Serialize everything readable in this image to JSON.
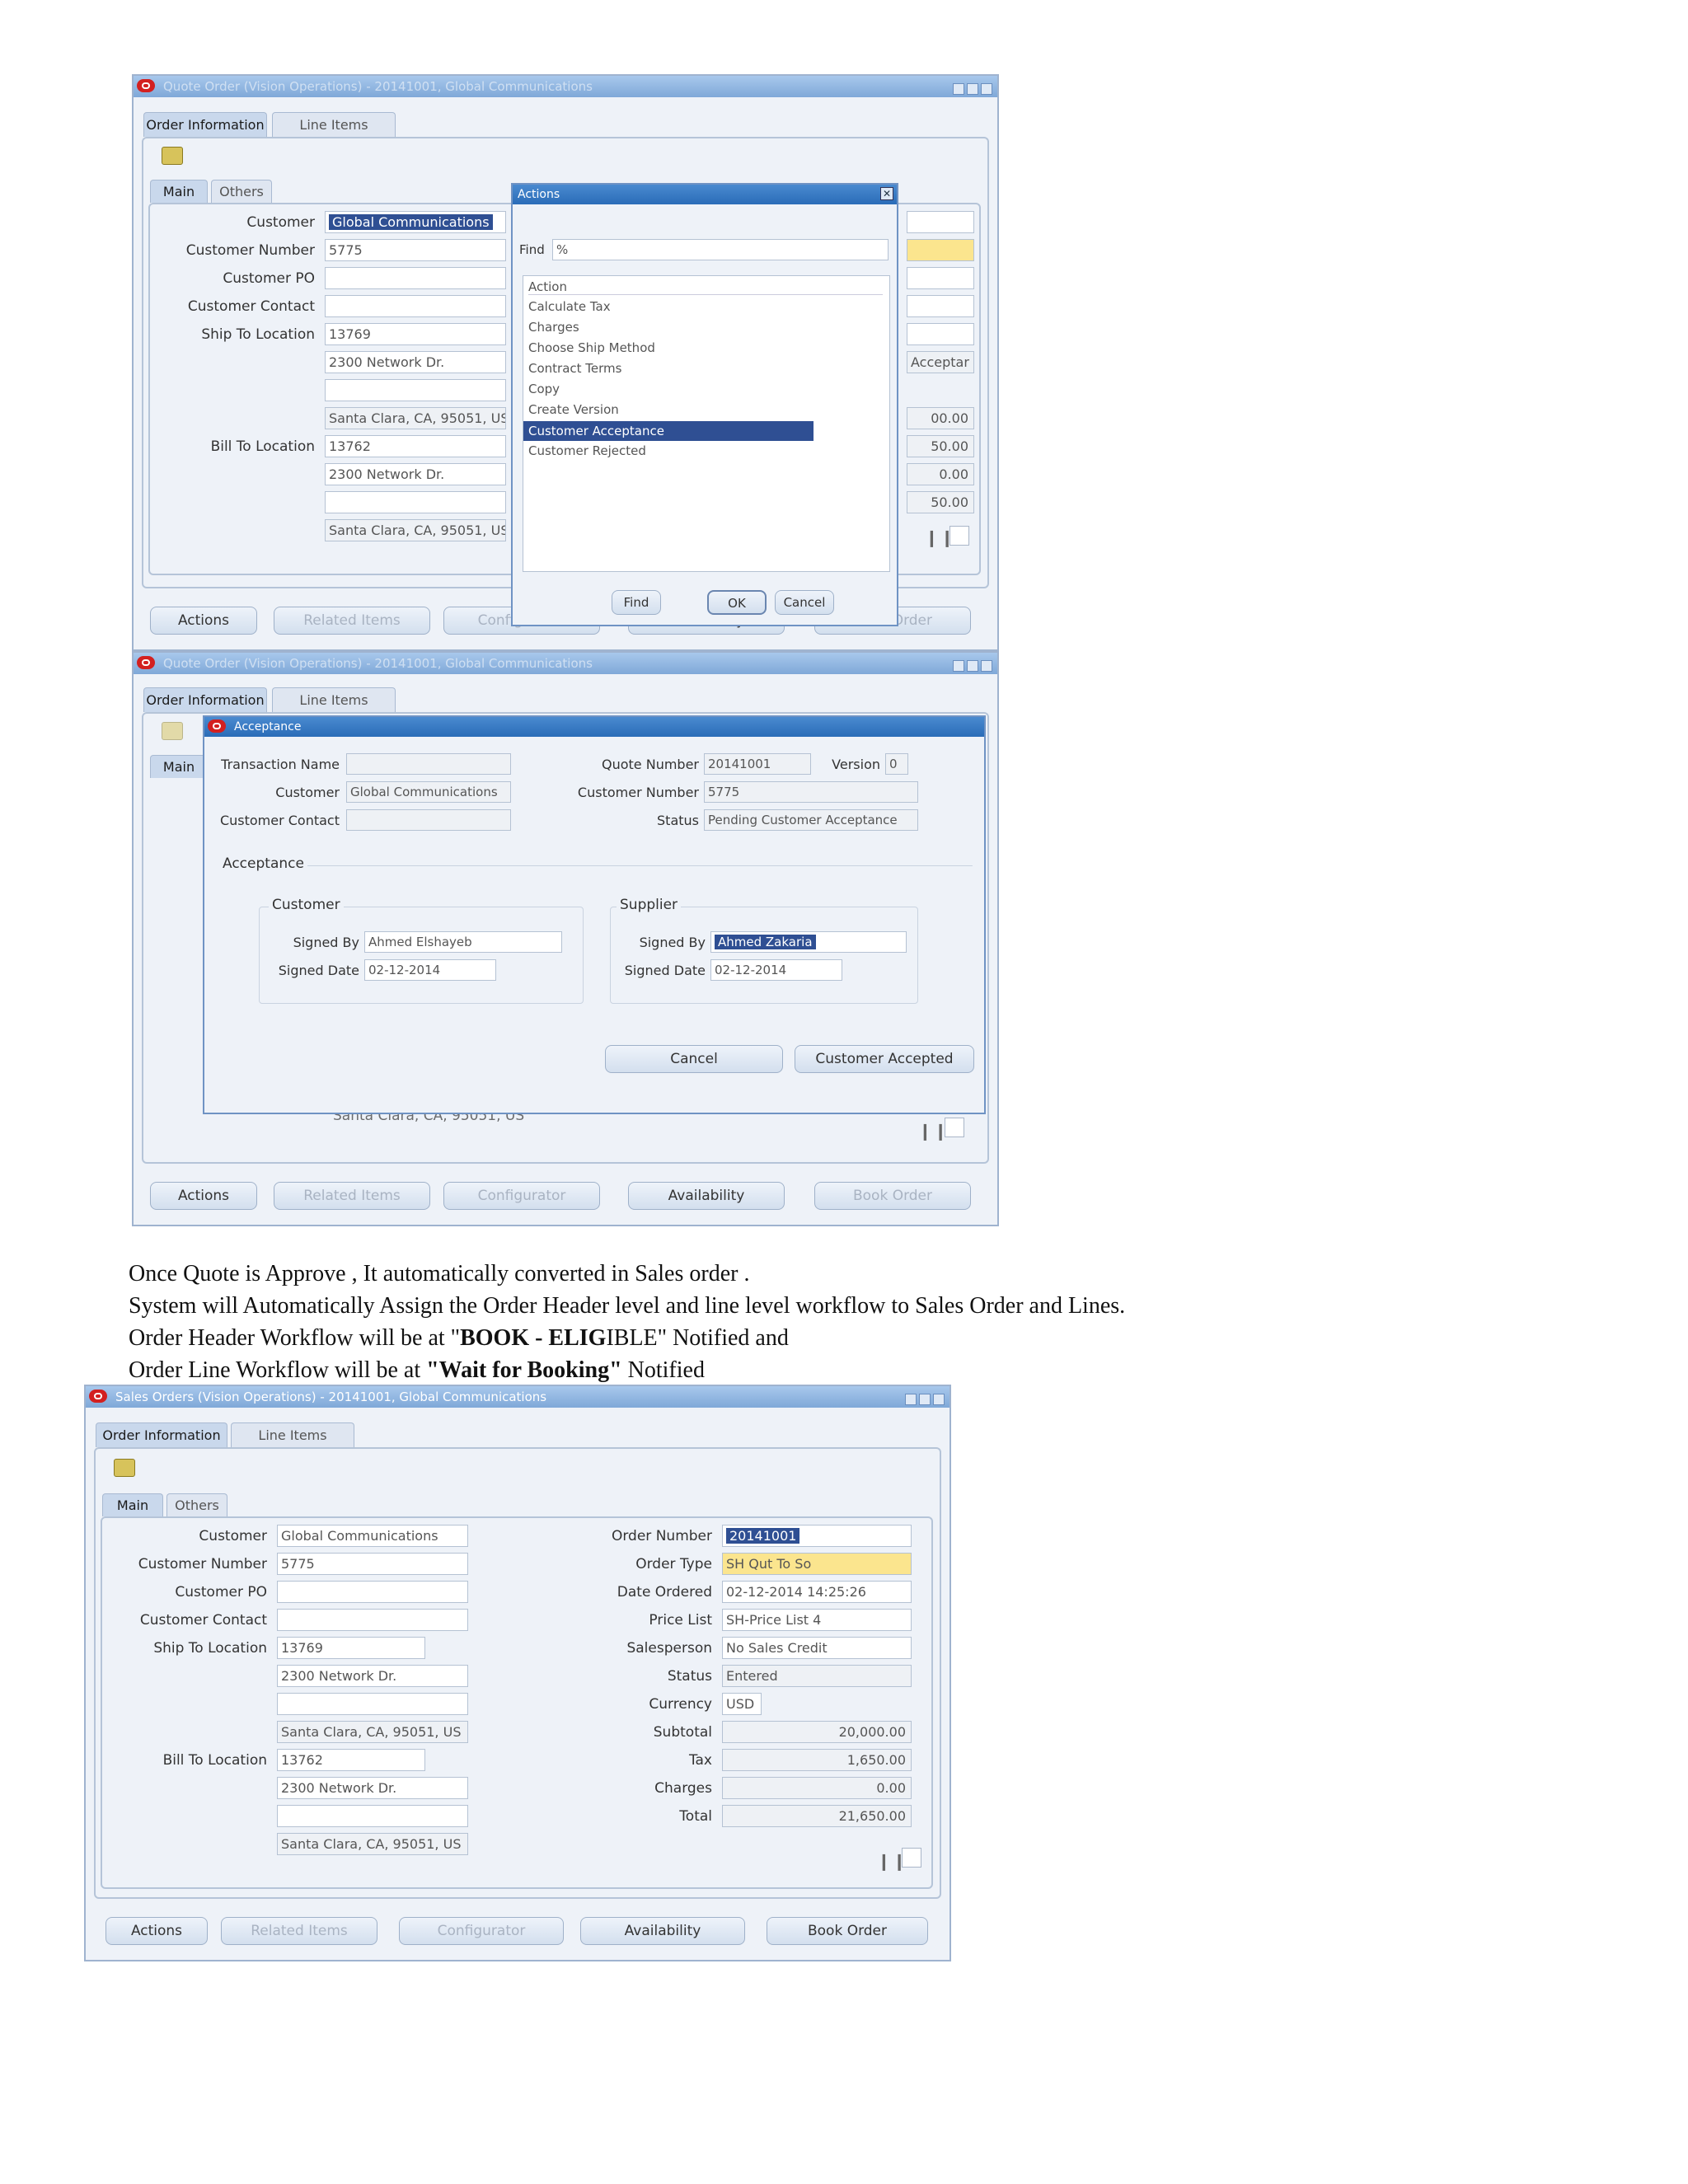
{
  "screen1": {
    "window_title": "Quote Order (Vision Operations) - 20141001, Global Communications",
    "tabs": [
      "Order Information",
      "Line Items"
    ],
    "subtabs": [
      "Main",
      "Others"
    ],
    "labels": [
      "Customer",
      "Customer Number",
      "Customer PO",
      "Customer Contact",
      "Ship To Location",
      "Bill To Location"
    ],
    "customer": "Global Communications",
    "customer_number": "5775",
    "ship_to": "13769",
    "ship_addr1": "2300 Network Dr.",
    "ship_addr2": "Santa Clara, CA, 95051, US",
    "bill_to": "13762",
    "bill_addr1": "2300 Network Dr.",
    "bill_addr2": "Santa Clara, CA, 95051, US",
    "right_partial": [
      "Acceptar",
      "00.00",
      "50.00",
      "0.00",
      "50.00"
    ],
    "buttons": [
      "Actions",
      "Related Items",
      "Configurator",
      "Availability",
      "Book Order"
    ],
    "dialog": {
      "title": "Actions",
      "find_label": "Find",
      "find_value": "%",
      "list_header": "Action",
      "items": [
        "Calculate Tax",
        "Charges",
        "Choose Ship Method",
        "Contract Terms",
        "Copy",
        "Create Version",
        "Customer Acceptance",
        "Customer Rejected"
      ],
      "selected": "Customer Acceptance",
      "buttons": [
        "Find",
        "OK",
        "Cancel"
      ]
    }
  },
  "screen2": {
    "window_title": "Quote Order (Vision Operations) - 20141001, Global Communications",
    "tabs": [
      "Order Information",
      "Line Items"
    ],
    "main_tab": "Main",
    "behind_text": "Santa Clara, CA, 95051, US",
    "buttons": [
      "Actions",
      "Related Items",
      "Configurator",
      "Availability",
      "Book Order"
    ],
    "dialog": {
      "title": "Acceptance",
      "transaction_name_label": "Transaction Name",
      "customer_label": "Customer",
      "customer": "Global Communications",
      "customer_contact_label": "Customer Contact",
      "quote_number_label": "Quote Number",
      "quote_number": "20141001",
      "version_label": "Version",
      "version": "0",
      "customer_number_label": "Customer Number",
      "customer_number": "5775",
      "status_label": "Status",
      "status": "Pending Customer Acceptance",
      "acceptance_label": "Acceptance",
      "customer_group": "Customer",
      "supplier_group": "Supplier",
      "signed_by_label": "Signed By",
      "signed_date_label": "Signed Date",
      "customer_signed_by": "Ahmed Elshayeb",
      "customer_signed_date": "02-12-2014",
      "supplier_signed_by": "Ahmed Zakaria",
      "supplier_signed_date": "02-12-2014",
      "cancel": "Cancel",
      "accept": "Customer Accepted"
    }
  },
  "text": {
    "line1": "Once Quote is Approve , It automatically converted in Sales order .",
    "line2": "System will Automatically Assign the Order Header level and line level workflow to Sales Order and Lines.",
    "line3_pre": "Order Header Workflow will be at \"",
    "line3_bold": "BOOK - ELIG",
    "line3_rest": "IBLE\"  Notified and",
    "line4_pre": "Order Line Workflow will be at ",
    "line4_bold": "\"Wait for Booking\"",
    "line4_post": " Notified"
  },
  "screen3": {
    "window_title": "Sales Orders (Vision Operations) - 20141001, Global Communications",
    "tabs": [
      "Order Information",
      "Line Items"
    ],
    "subtabs": [
      "Main",
      "Others"
    ],
    "left_labels": [
      "Customer",
      "Customer Number",
      "Customer PO",
      "Customer Contact",
      "Ship To Location",
      "Bill To Location"
    ],
    "customer": "Global Communications",
    "customer_number": "5775",
    "ship_to": "13769",
    "ship_addr1": "2300 Network Dr.",
    "ship_addr2": "Santa Clara, CA, 95051, US",
    "bill_to": "13762",
    "bill_addr1": "2300 Network Dr.",
    "bill_addr2": "Santa Clara, CA, 95051, US",
    "right_labels": [
      "Order Number",
      "Order Type",
      "Date Ordered",
      "Price List",
      "Salesperson",
      "Status",
      "Currency",
      "Subtotal",
      "Tax",
      "Charges",
      "Total"
    ],
    "order_number": "20141001",
    "order_type": "SH Qut To So",
    "date_ordered": "02-12-2014 14:25:26",
    "price_list": "SH-Price List 4",
    "salesperson": "No Sales Credit",
    "status": "Entered",
    "currency": "USD",
    "subtotal": "20,000.00",
    "tax": "1,650.00",
    "charges": "0.00",
    "total": "21,650.00",
    "buttons": [
      "Actions",
      "Related Items",
      "Configurator",
      "Availability",
      "Book Order"
    ]
  }
}
